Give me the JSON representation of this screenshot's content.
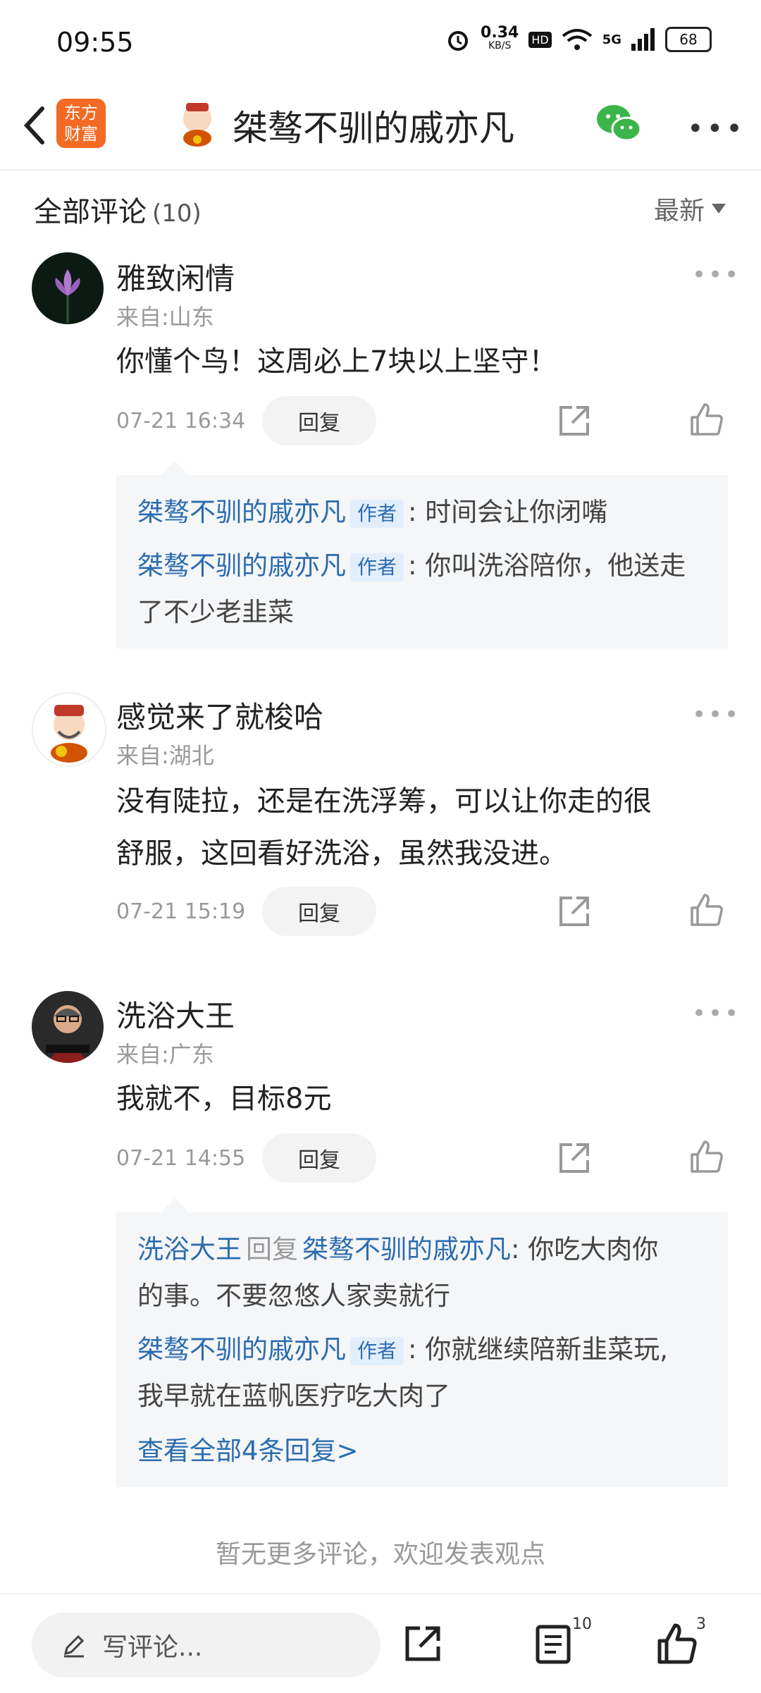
{
  "status": {
    "time": "09:55",
    "net_speed": "0.34",
    "net_unit": "KB/S",
    "hd": "HD",
    "signal": "5G",
    "battery": "68"
  },
  "header": {
    "app_logo_line1": "东方",
    "app_logo_line2": "财富",
    "title": "桀骜不驯的戚亦凡"
  },
  "comments_header": {
    "title": "全部评论",
    "count": "(10)",
    "sort_label": "最新"
  },
  "comments": [
    {
      "user": "雅致闲情",
      "location": "来自:山东",
      "text": "你懂个鸟！这周必上7块以上坚守！",
      "date": "07-21 16:34",
      "reply_label": "回复",
      "replies": [
        {
          "name": "桀骜不驯的戚亦凡",
          "tag": "作者",
          "text": ": 时间会让你闭嘴"
        },
        {
          "name": "桀骜不驯的戚亦凡",
          "tag": "作者",
          "text": ": 你叫洗浴陪你，他送走",
          "text2": "了不少老韭菜"
        }
      ]
    },
    {
      "user": "感觉来了就梭哈",
      "location": "来自:湖北",
      "text_line1": "没有陡拉，还是在洗浮筹，可以让你走的很",
      "text_line2": "舒服，这回看好洗浴，虽然我没进。",
      "date": "07-21 15:19",
      "reply_label": "回复"
    },
    {
      "user": "洗浴大王",
      "location": "来自:广东",
      "text": "我就不，目标8元",
      "date": "07-21 14:55",
      "reply_label": "回复",
      "replies": [
        {
          "name": "洗浴大王",
          "reply_word": "回复",
          "target": "桀骜不驯的戚亦凡",
          "text": ": 你吃大肉你",
          "text2": "的事。不要忽悠人家卖就行"
        },
        {
          "name": "桀骜不驯的戚亦凡",
          "tag": "作者",
          "text": ": 你就继续陪新韭菜玩,",
          "text2": "我早就在蓝帆医疗吃大肉了"
        }
      ],
      "view_all": "查看全部4条回复>"
    }
  ],
  "no_more": "暂无更多评论，欢迎发表观点",
  "bottom": {
    "input_placeholder": "写评论...",
    "comment_count": "10",
    "like_count": "3"
  },
  "colors": {
    "link": "#2b6cb0",
    "brand": "#f36a24"
  }
}
